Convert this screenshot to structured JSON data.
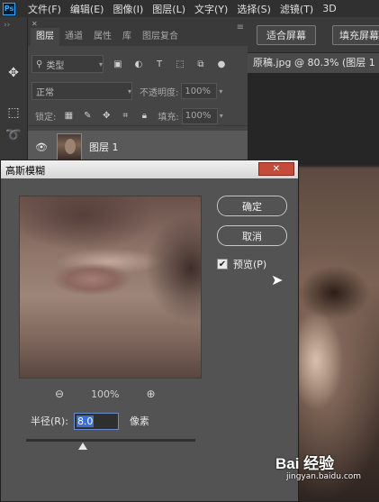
{
  "menubar": {
    "logo": "Ps",
    "items": [
      "文件(F)",
      "编辑(E)",
      "图像(I)",
      "图层(L)",
      "文字(Y)",
      "选择(S)",
      "滤镜(T)",
      "3D"
    ]
  },
  "layers_panel": {
    "tabs": [
      "图层",
      "通道",
      "属性",
      "库",
      "图层复合"
    ],
    "filter_label": "类型",
    "blend_mode": "正常",
    "opacity_label": "不透明度:",
    "opacity_value": "100%",
    "lock_label": "锁定:",
    "fill_label": "填充:",
    "fill_value": "100%",
    "layer_name": "图层 1"
  },
  "options_bar": {
    "fit_screen": "适合屏幕",
    "fill_screen": "填充屏幕"
  },
  "document_tab": "原稿.jpg @ 80.3% (图层 1",
  "gaussian_blur_dialog": {
    "title": "高斯模糊",
    "ok_label": "确定",
    "cancel_label": "取消",
    "preview_label": "预览(P)",
    "preview_checked": true,
    "zoom_level": "100%",
    "radius_label": "半径(R):",
    "radius_value": "8.0",
    "radius_unit": "像素"
  },
  "watermark": {
    "logo": "Bai 经验",
    "url": "jingyan.baidu.com"
  }
}
